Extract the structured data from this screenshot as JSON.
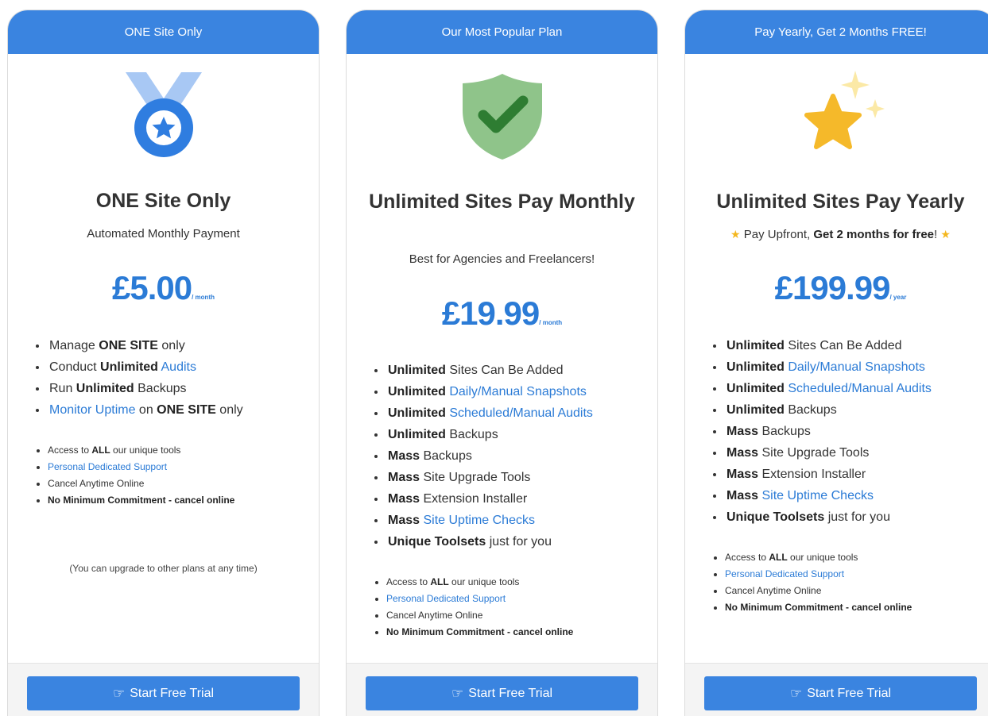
{
  "colors": {
    "accent": "#3a84e0",
    "price": "#2b7bd6",
    "link": "#2b7bd6",
    "star": "#f4b71e",
    "shield": "#8fc48a",
    "check": "#2e7d32"
  },
  "cards": [
    {
      "header": "ONE Site Only",
      "icon": "medal-icon",
      "title": "ONE Site Only",
      "subtitle": "Automated Monthly Payment",
      "price": "£5.00",
      "period": "/ month",
      "features": [
        {
          "parts": [
            {
              "t": "Manage "
            },
            {
              "t": "ONE SITE",
              "b": true
            },
            {
              "t": " only"
            }
          ]
        },
        {
          "parts": [
            {
              "t": "Conduct "
            },
            {
              "t": "Unlimited",
              "b": true
            },
            {
              "t": " "
            },
            {
              "t": "Audits",
              "l": true
            }
          ]
        },
        {
          "parts": [
            {
              "t": "Run "
            },
            {
              "t": "Unlimited",
              "b": true
            },
            {
              "t": " Backups"
            }
          ]
        },
        {
          "parts": [
            {
              "t": "Monitor Uptime",
              "l": true
            },
            {
              "t": " on "
            },
            {
              "t": "ONE SITE",
              "b": true
            },
            {
              "t": " only"
            }
          ]
        }
      ],
      "extras": [
        {
          "parts": [
            {
              "t": "Access to "
            },
            {
              "t": "ALL",
              "b": true
            },
            {
              "t": " our unique tools"
            }
          ]
        },
        {
          "parts": [
            {
              "t": "Personal Dedicated Support",
              "l": true
            }
          ]
        },
        {
          "parts": [
            {
              "t": "Cancel Anytime Online"
            }
          ]
        },
        {
          "parts": [
            {
              "t": "No Minimum Commitment - cancel online",
              "b": true
            }
          ]
        }
      ],
      "note": "(You can upgrade to other plans at any time)",
      "button": "Start Free Trial"
    },
    {
      "header": "Our Most Popular Plan",
      "icon": "shield-check-icon",
      "title": "Unlimited Sites Pay Monthly",
      "subtitle": "Best for Agencies and Freelancers!",
      "price": "£19.99",
      "period": "/ month",
      "features": [
        {
          "parts": [
            {
              "t": "Unlimited",
              "b": true
            },
            {
              "t": " Sites Can Be Added"
            }
          ]
        },
        {
          "parts": [
            {
              "t": "Unlimited",
              "b": true
            },
            {
              "t": " "
            },
            {
              "t": "Daily/Manual Snapshots",
              "l": true
            }
          ]
        },
        {
          "parts": [
            {
              "t": "Unlimited",
              "b": true
            },
            {
              "t": " "
            },
            {
              "t": "Scheduled/Manual Audits",
              "l": true
            }
          ]
        },
        {
          "parts": [
            {
              "t": "Unlimited",
              "b": true
            },
            {
              "t": " Backups"
            }
          ]
        },
        {
          "parts": [
            {
              "t": "Mass",
              "b": true
            },
            {
              "t": " Backups"
            }
          ]
        },
        {
          "parts": [
            {
              "t": "Mass",
              "b": true
            },
            {
              "t": " Site Upgrade Tools"
            }
          ]
        },
        {
          "parts": [
            {
              "t": "Mass",
              "b": true
            },
            {
              "t": " Extension Installer"
            }
          ]
        },
        {
          "parts": [
            {
              "t": "Mass",
              "b": true
            },
            {
              "t": " "
            },
            {
              "t": "Site Uptime Checks",
              "l": true
            }
          ]
        },
        {
          "parts": [
            {
              "t": "Unique Toolsets",
              "b": true
            },
            {
              "t": " just for you"
            }
          ]
        }
      ],
      "extras": [
        {
          "parts": [
            {
              "t": "Access to "
            },
            {
              "t": "ALL",
              "b": true
            },
            {
              "t": " our unique tools"
            }
          ]
        },
        {
          "parts": [
            {
              "t": "Personal Dedicated Support",
              "l": true
            }
          ]
        },
        {
          "parts": [
            {
              "t": "Cancel Anytime Online"
            }
          ]
        },
        {
          "parts": [
            {
              "t": "No Minimum Commitment - cancel online",
              "b": true
            }
          ]
        }
      ],
      "button": "Start Free Trial"
    },
    {
      "header": "Pay Yearly, Get 2 Months FREE!",
      "icon": "sparkle-star-icon",
      "title": "Unlimited Sites Pay Yearly",
      "subtitle_parts": [
        {
          "t": " Pay Upfront, "
        },
        {
          "t": "Get 2 months for free",
          "b": true
        },
        {
          "t": "! "
        }
      ],
      "price": "£199.99",
      "period": "/ year",
      "features": [
        {
          "parts": [
            {
              "t": "Unlimited",
              "b": true
            },
            {
              "t": " Sites Can Be Added"
            }
          ]
        },
        {
          "parts": [
            {
              "t": "Unlimited",
              "b": true
            },
            {
              "t": " "
            },
            {
              "t": "Daily/Manual Snapshots",
              "l": true
            }
          ]
        },
        {
          "parts": [
            {
              "t": "Unlimited",
              "b": true
            },
            {
              "t": " "
            },
            {
              "t": "Scheduled/Manual Audits",
              "l": true
            }
          ]
        },
        {
          "parts": [
            {
              "t": "Unlimited",
              "b": true
            },
            {
              "t": " Backups"
            }
          ]
        },
        {
          "parts": [
            {
              "t": "Mass",
              "b": true
            },
            {
              "t": " Backups"
            }
          ]
        },
        {
          "parts": [
            {
              "t": "Mass",
              "b": true
            },
            {
              "t": " Site Upgrade Tools"
            }
          ]
        },
        {
          "parts": [
            {
              "t": "Mass",
              "b": true
            },
            {
              "t": " Extension Installer"
            }
          ]
        },
        {
          "parts": [
            {
              "t": "Mass",
              "b": true
            },
            {
              "t": " "
            },
            {
              "t": "Site Uptime Checks",
              "l": true
            }
          ]
        },
        {
          "parts": [
            {
              "t": "Unique Toolsets",
              "b": true
            },
            {
              "t": " just for you"
            }
          ]
        }
      ],
      "extras": [
        {
          "parts": [
            {
              "t": "Access to "
            },
            {
              "t": "ALL",
              "b": true
            },
            {
              "t": " our unique tools"
            }
          ]
        },
        {
          "parts": [
            {
              "t": "Personal Dedicated Support",
              "l": true
            }
          ]
        },
        {
          "parts": [
            {
              "t": "Cancel Anytime Online"
            }
          ]
        },
        {
          "parts": [
            {
              "t": "No Minimum Commitment - cancel online",
              "b": true
            }
          ]
        }
      ],
      "button": "Start Free Trial"
    }
  ]
}
